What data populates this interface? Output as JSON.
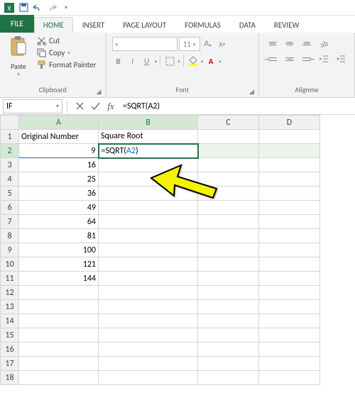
{
  "qat": {
    "save": "Save",
    "undo": "Undo",
    "redo": "Redo"
  },
  "tabs": {
    "file": "FILE",
    "home": "HOME",
    "insert": "INSERT",
    "page_layout": "PAGE LAYOUT",
    "formulas": "FORMULAS",
    "data": "DATA",
    "review": "REVIEW"
  },
  "ribbon": {
    "clipboard": {
      "paste": "Paste",
      "cut": "Cut",
      "copy": "Copy",
      "format_painter": "Format Painter",
      "label": "Clipboard"
    },
    "font": {
      "label": "Font",
      "size": "11",
      "bold": "B",
      "italic": "I",
      "underline": "U"
    },
    "alignment": {
      "label": "Alignme"
    }
  },
  "formula_bar": {
    "name_box": "IF",
    "fx": "fx",
    "formula": "=SQRT(A2)"
  },
  "columns": [
    "A",
    "B",
    "C",
    "D"
  ],
  "rows": [
    "1",
    "2",
    "3",
    "4",
    "5",
    "6",
    "7",
    "8",
    "9",
    "10",
    "11",
    "12",
    "13",
    "14",
    "15",
    "16",
    "17",
    "18"
  ],
  "headers": {
    "A": "Original Number",
    "B": "Square Root"
  },
  "colA_values": {
    "2": "9",
    "3": "16",
    "4": "25",
    "5": "36",
    "6": "49",
    "7": "64",
    "8": "81",
    "9": "100",
    "10": "121",
    "11": "144"
  },
  "editing_cell": {
    "prefix": "=SQRT(",
    "ref": "A2",
    "suffix": ")"
  },
  "chart_data": {
    "type": "table",
    "columns": [
      "Original Number",
      "Square Root"
    ],
    "rows": [
      [
        9,
        null
      ],
      [
        16,
        null
      ],
      [
        25,
        null
      ],
      [
        36,
        null
      ],
      [
        49,
        null
      ],
      [
        64,
        null
      ],
      [
        81,
        null
      ],
      [
        100,
        null
      ],
      [
        121,
        null
      ],
      [
        144,
        null
      ]
    ],
    "formula_B2": "=SQRT(A2)"
  }
}
